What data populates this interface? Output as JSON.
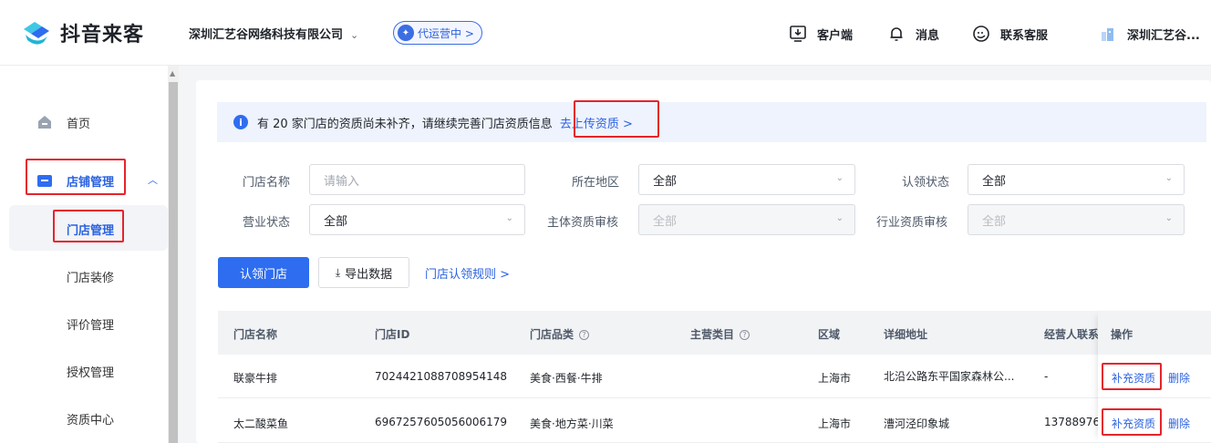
{
  "header": {
    "logo_text": "抖音来客",
    "company": "深圳汇艺谷网络科技有限公司",
    "agent_badge": "代运营中 >",
    "nav": [
      {
        "label": "客户端",
        "icon": "download-client-icon"
      },
      {
        "label": "消息",
        "icon": "bell-icon"
      },
      {
        "label": "联系客服",
        "icon": "customer-service-icon"
      },
      {
        "label": "深圳汇艺谷...",
        "icon": "account-avatar-icon"
      }
    ]
  },
  "sidebar": {
    "home": "首页",
    "store_mgmt": "店铺管理",
    "sub_items": [
      "门店管理",
      "门店装修",
      "评价管理",
      "授权管理",
      "资质中心"
    ]
  },
  "notice": {
    "text": "有 20 家门店的资质尚未补齐，请继续完善门店资质信息",
    "link": "去上传资质 >"
  },
  "filters": {
    "store_name_label": "门店名称",
    "store_name_placeholder": "请输入",
    "region_label": "所在地区",
    "region_value": "全部",
    "claim_status_label": "认领状态",
    "claim_status_value": "全部",
    "business_status_label": "营业状态",
    "business_status_value": "全部",
    "entity_audit_label": "主体资质审核",
    "entity_audit_value": "全部",
    "industry_audit_label": "行业资质审核",
    "industry_audit_value": "全部"
  },
  "actions": {
    "claim_store": "认领门店",
    "export_data": "导出数据",
    "claim_rules": "门店认领规则 >"
  },
  "table": {
    "headers": [
      "门店名称",
      "门店ID",
      "门店品类",
      "主营类目",
      "区域",
      "详细地址",
      "经营人联系",
      "操作"
    ],
    "rows": [
      {
        "name": "联豪牛排",
        "id": "7024421088708954148",
        "category": "美食·西餐·牛排",
        "main_category": "",
        "region": "上海市",
        "address": "北沿公路东平国家森林公...",
        "contact": "-",
        "op1": "补充资质",
        "op2": "删除"
      },
      {
        "name": "太二酸菜鱼",
        "id": "6967257605056006179",
        "category": "美食·地方菜·川菜",
        "main_category": "",
        "region": "上海市",
        "address": "漕河泾印象城",
        "contact": "13788976",
        "op1": "补充资质",
        "op2": "删除"
      }
    ]
  },
  "colors": {
    "primary": "#2e6df0",
    "highlight_box": "#e5242b",
    "notice_bg": "#eef3fd"
  }
}
